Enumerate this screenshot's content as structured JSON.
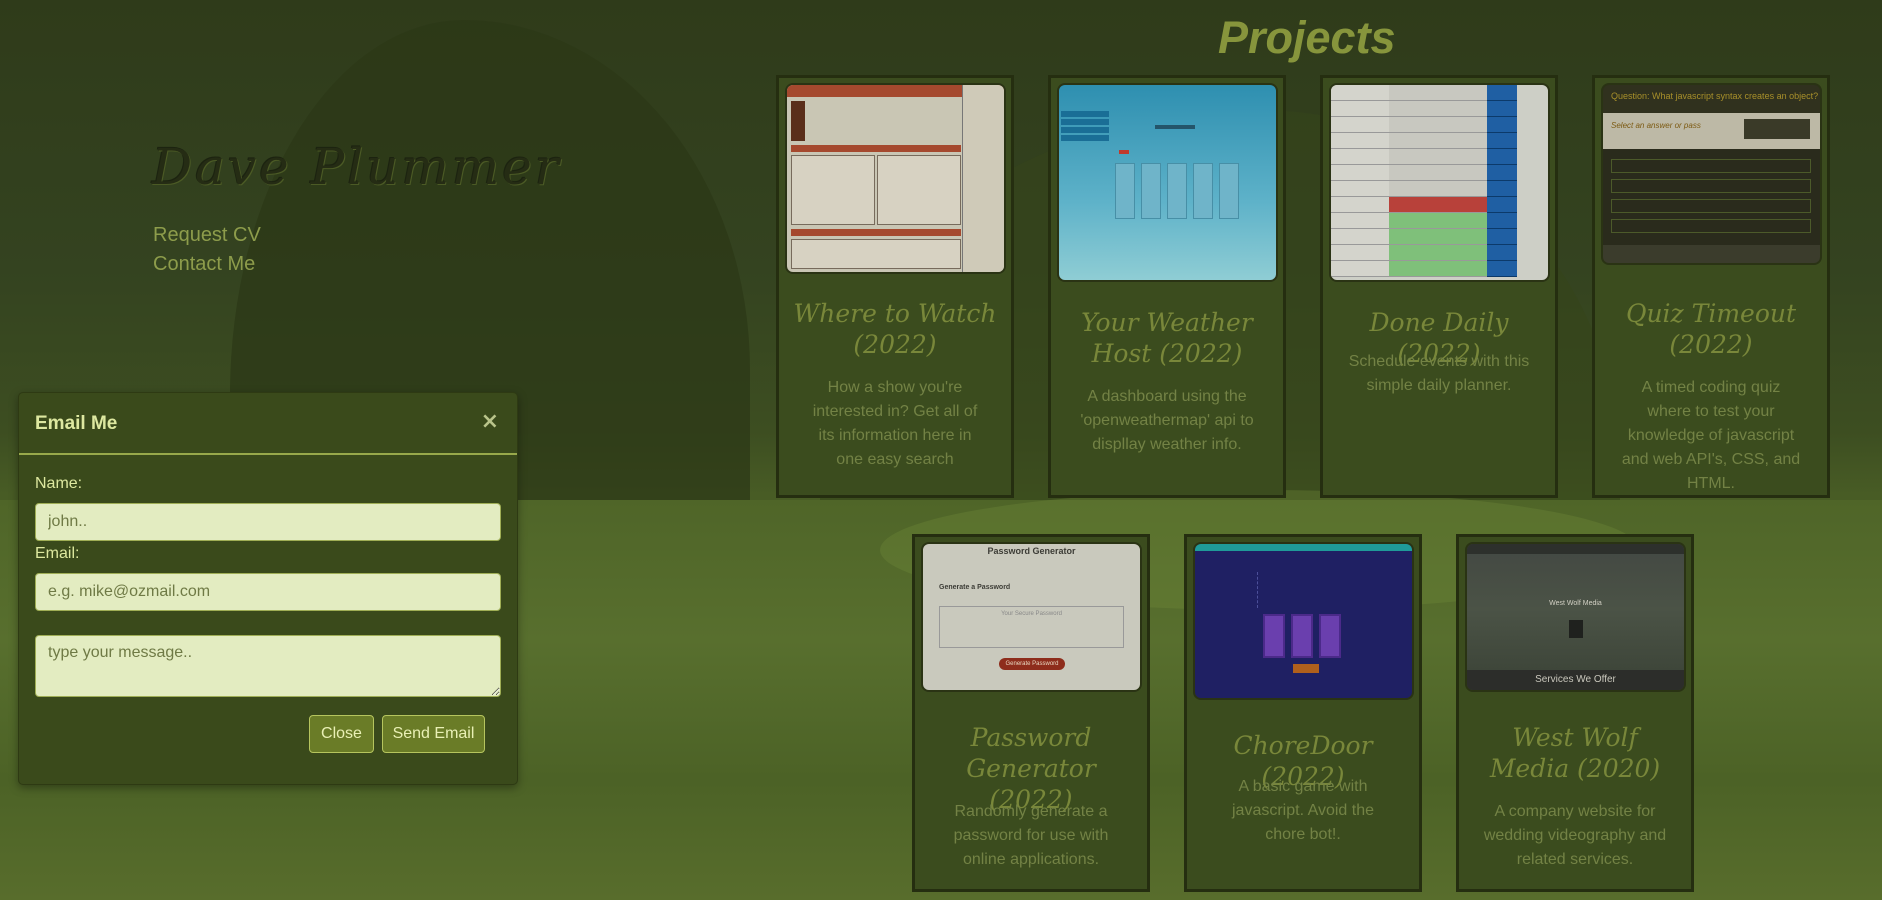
{
  "profile": {
    "name": "Dave Plummer",
    "links": [
      {
        "label": "Request CV"
      },
      {
        "label": "Contact Me"
      }
    ]
  },
  "projects": {
    "title": "Projects",
    "cards": [
      {
        "title": "Where to Watch (2022)",
        "description": "How a show you're interested in? Get all of its information here in one easy search"
      },
      {
        "title": "Your Weather Host (2022)",
        "description": "A dashboard using the 'openweathermap' api to displlay weather info."
      },
      {
        "title": "Done Daily (2022)",
        "description": "Schedule events with this simple daily planner."
      },
      {
        "title": "Quiz Timeout (2022)",
        "description": "A timed coding quiz where to test your knowledge of javascript and web API's, CSS, and HTML."
      },
      {
        "title": "Password Generator (2022)",
        "description": "Randomly generate a password for use with online applications."
      },
      {
        "title": "ChoreDoor (2022)",
        "description": "A basic game with javascript. Avoid the chore bot!."
      },
      {
        "title": "West Wolf Media (2020)",
        "description": "A company website for wedding videography and related services."
      }
    ],
    "thumb_text": {
      "pw_title": "Password Generator",
      "pw_subtitle": "Generate a Password",
      "pw_placeholder": "Your Secure Password",
      "pw_button": "Generate Password",
      "quiz_question": "Question: What javascript syntax creates an object?",
      "quiz_prompt": "Select an answer or pass",
      "wolf_footer": "Services We Offer",
      "wolf_title": "West Wolf Media"
    }
  },
  "modal": {
    "title": "Email Me",
    "close_icon": "×",
    "name_label": "Name:",
    "name_placeholder": "john..",
    "email_label": "Email:",
    "email_placeholder": "e.g. mike@ozmail.com",
    "message_placeholder": "type your message..",
    "close_button": "Close",
    "send_button": "Send Email"
  }
}
